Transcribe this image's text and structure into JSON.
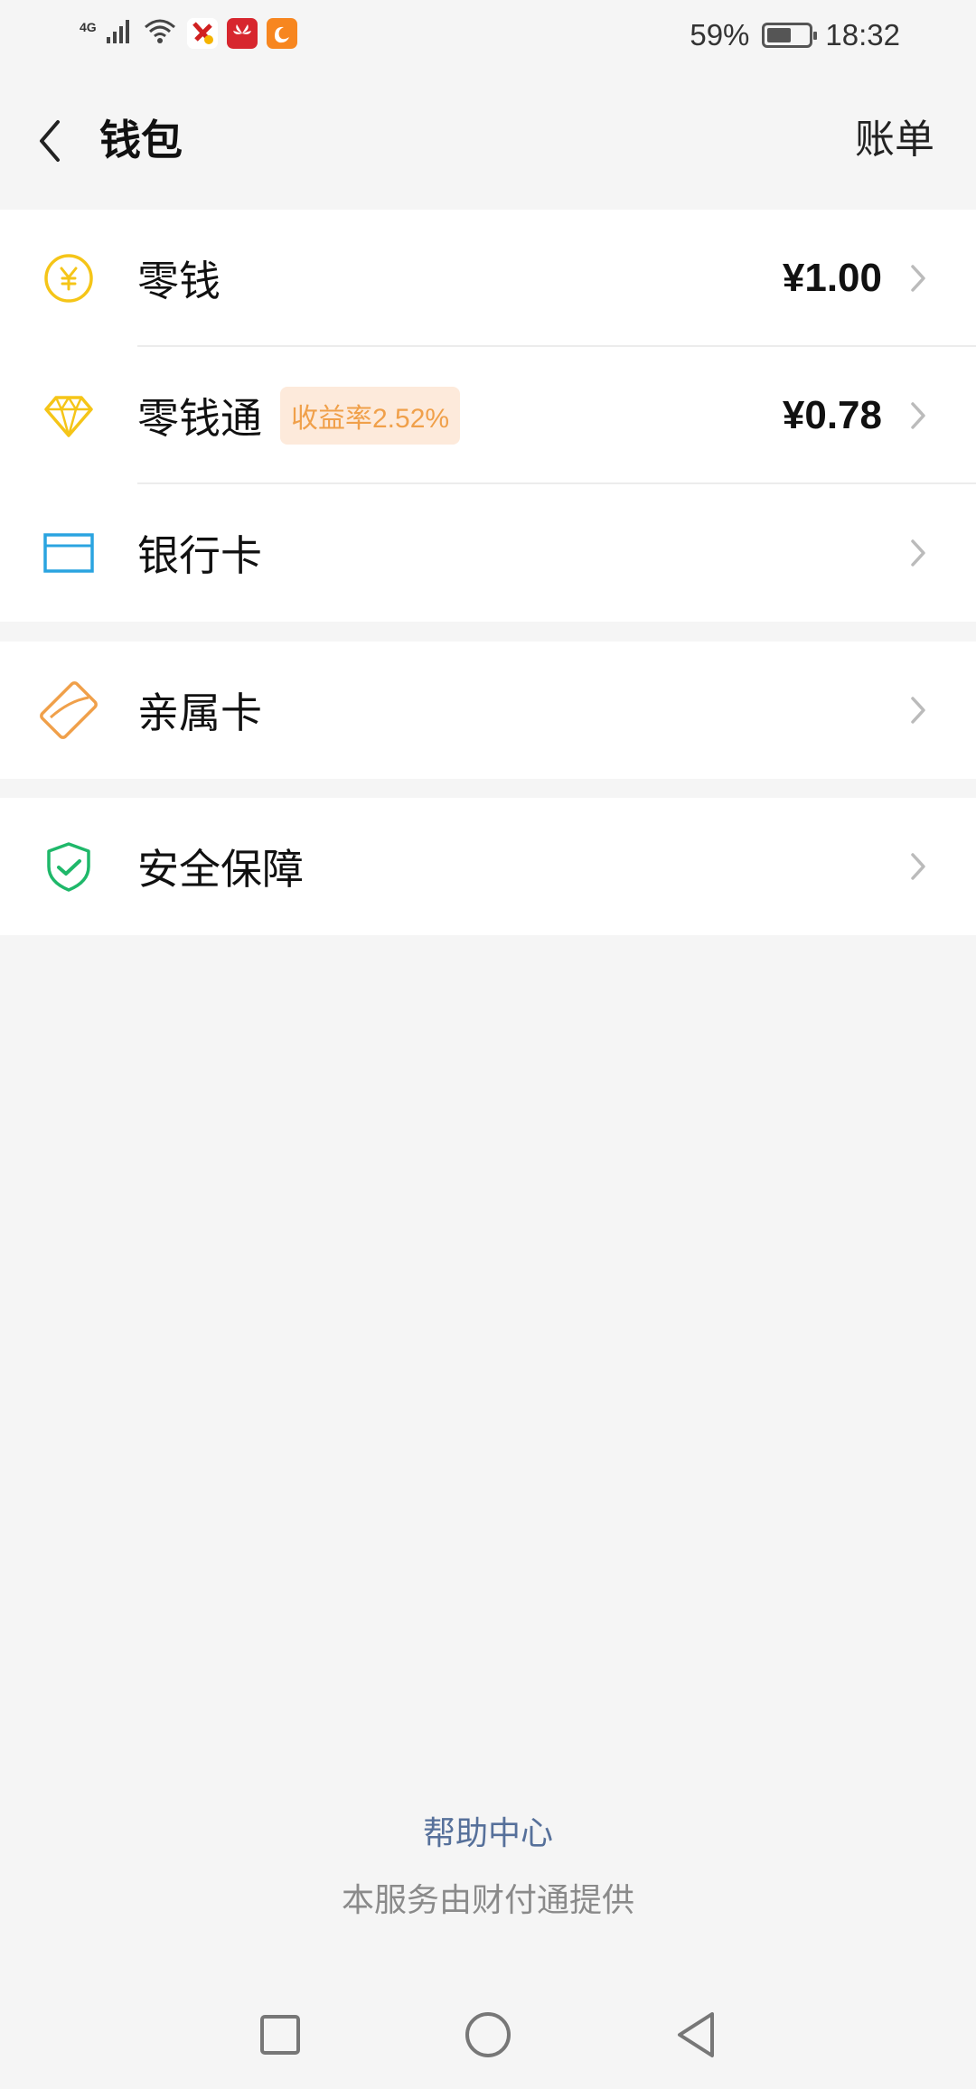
{
  "status_bar": {
    "network": "4G",
    "battery_percent": "59%",
    "battery_level": 0.59,
    "time": "18:32",
    "app_icons": [
      "sms-app-icon",
      "huawei-app-icon",
      "uc-browser-icon"
    ]
  },
  "nav": {
    "title": "钱包",
    "right_label": "账单"
  },
  "wallet": {
    "items": [
      {
        "label": "零钱",
        "amount": "¥1.00",
        "icon": "yuan-coin-icon",
        "color": "#f5c518"
      },
      {
        "label": "零钱通",
        "badge": "收益率2.52%",
        "amount": "¥0.78",
        "icon": "diamond-icon",
        "color": "#f5c518"
      },
      {
        "label": "银行卡",
        "icon": "bank-card-icon",
        "color": "#2aa4e0"
      }
    ]
  },
  "family": {
    "label": "亲属卡",
    "icon": "family-card-icon",
    "color": "#f0a04a"
  },
  "security": {
    "label": "安全保障",
    "icon": "shield-check-icon",
    "color": "#1fb86a"
  },
  "footer": {
    "help": "帮助中心",
    "note": "本服务由财付通提供"
  }
}
